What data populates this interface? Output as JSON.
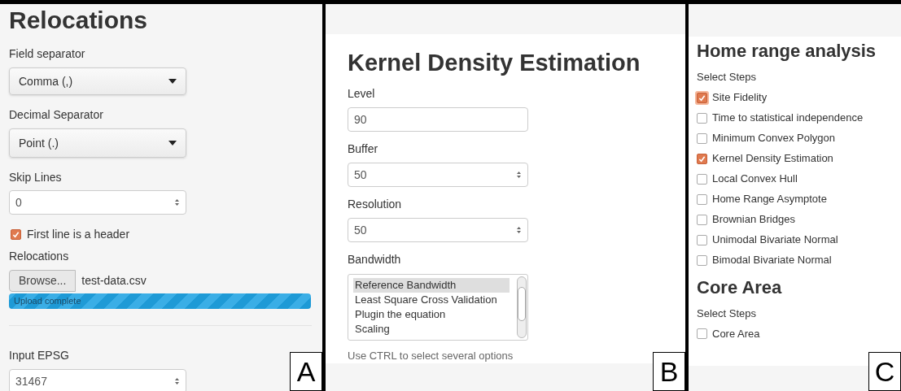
{
  "panel_a": {
    "label": "A",
    "title": "Relocations",
    "field_separator": {
      "label": "Field separator",
      "value": "Comma (,)"
    },
    "decimal_separator": {
      "label": "Decimal Separator",
      "value": "Point (.)"
    },
    "skip_lines": {
      "label": "Skip Lines",
      "value": "0"
    },
    "header_checkbox": {
      "label": "First line is a header",
      "checked": true
    },
    "file_input": {
      "label": "Relocations",
      "button": "Browse...",
      "file_name": "test-data.csv"
    },
    "upload_progress": {
      "text": "Upload complete",
      "level": 1
    },
    "input_epsg": {
      "label": "Input EPSG",
      "value": "31467"
    }
  },
  "panel_b": {
    "label": "B",
    "title": "Kernel Density Estimation",
    "fields": [
      {
        "label": "Level",
        "value": "90",
        "kind": "text"
      },
      {
        "label": "Buffer",
        "value": "50",
        "kind": "number"
      },
      {
        "label": "Resolution",
        "value": "50",
        "kind": "number"
      }
    ],
    "bandwidth": {
      "label": "Bandwidth",
      "options": [
        {
          "text": "Reference Bandwidth",
          "selected": true
        },
        {
          "text": "Least Square Cross Validation",
          "selected": false
        },
        {
          "text": "Plugin the equation",
          "selected": false
        },
        {
          "text": "Scaling",
          "selected": false
        }
      ],
      "help": "Use CTRL to select several options"
    }
  },
  "panel_c": {
    "label": "C",
    "sections": [
      {
        "title": "Home range analysis",
        "subtitle": "Select Steps",
        "steps": [
          {
            "label": "Site Fidelity",
            "checked": true,
            "focused": true
          },
          {
            "label": "Time to statistical independence",
            "checked": false,
            "focused": false
          },
          {
            "label": "Minimum Convex Polygon",
            "checked": false,
            "focused": false
          },
          {
            "label": "Kernel Density Estimation",
            "checked": true,
            "focused": false
          },
          {
            "label": "Local Convex Hull",
            "checked": false,
            "focused": false
          },
          {
            "label": "Home Range Asymptote",
            "checked": false,
            "focused": false
          },
          {
            "label": "Brownian Bridges",
            "checked": false,
            "focused": false
          },
          {
            "label": "Unimodal Bivariate Normal",
            "checked": false,
            "focused": false
          },
          {
            "label": "Bimodal Bivariate Normal",
            "checked": false,
            "focused": false
          }
        ]
      },
      {
        "title": "Core Area",
        "subtitle": "Select Steps",
        "steps": [
          {
            "label": "Core Area",
            "checked": false,
            "focused": false
          }
        ]
      }
    ]
  }
}
